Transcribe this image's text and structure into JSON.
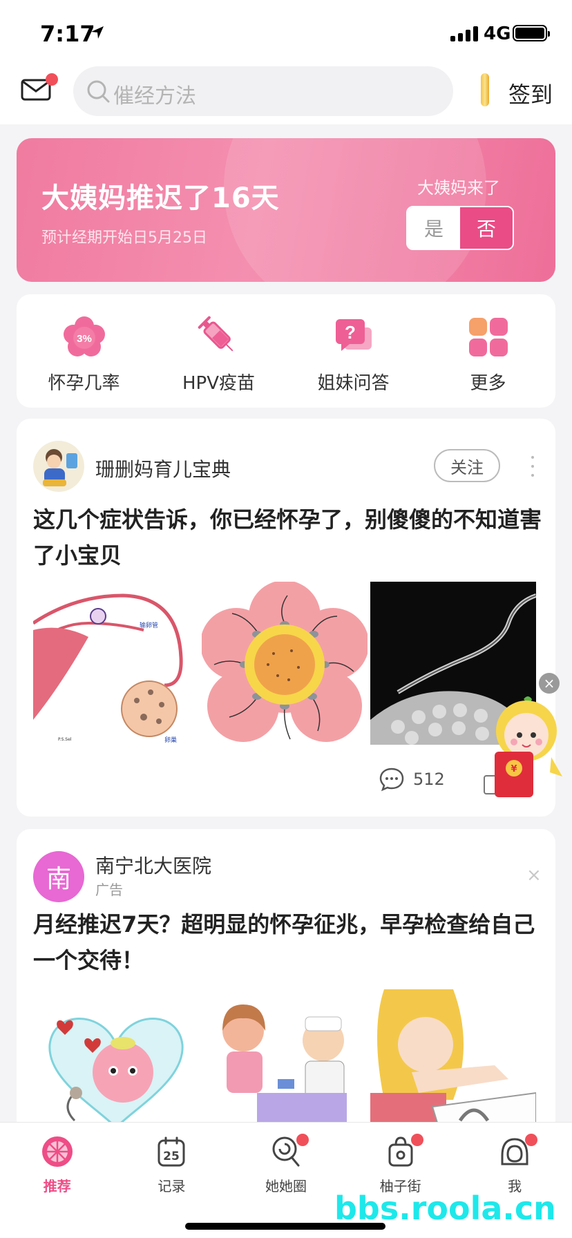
{
  "status_bar": {
    "time": "7:17",
    "network": "4G"
  },
  "header": {
    "search_placeholder": "催经方法",
    "signin_label": "签到"
  },
  "period_banner": {
    "title": "大姨妈推迟了16天",
    "subtitle": "预计经期开始日5月25日",
    "question": "大姨妈来了",
    "yes_label": "是",
    "no_label": "否",
    "accent_color": "#ea4c86"
  },
  "tools": [
    {
      "label": "怀孕几率",
      "icon": "pregnancy-rate-icon",
      "badge_text": "3%"
    },
    {
      "label": "HPV疫苗",
      "icon": "vaccine-syringe-icon"
    },
    {
      "label": "姐妹问答",
      "icon": "qa-bubble-icon",
      "badge_text": "?"
    },
    {
      "label": "更多",
      "icon": "more-grid-icon"
    }
  ],
  "feed": [
    {
      "author": "珊删妈育儿宝典",
      "follow_label": "关注",
      "title": "这几个症状告诉，你已经怀孕了，别傻傻的不知道害了小宝贝",
      "image_texts": [
        "输卵管",
        "卵巢",
        "P.S.Sel"
      ],
      "comments": "512"
    },
    {
      "author": "南宁北大医院",
      "avatar_text": "南",
      "tag": "广告",
      "close": "×",
      "title": "月经推迟7天？超明显的怀孕征兆，早孕检查给自己一个交待！"
    }
  ],
  "floating": {
    "close": "×",
    "coin_symbol": "¥"
  },
  "tabbar": [
    {
      "label": "推荐",
      "active": true
    },
    {
      "label": "记录",
      "icon_text": "25"
    },
    {
      "label": "她她圈",
      "badge": true
    },
    {
      "label": "柚子街",
      "badge": true
    },
    {
      "label": "我",
      "badge": true
    }
  ],
  "watermark": "bbs.roola.cn"
}
